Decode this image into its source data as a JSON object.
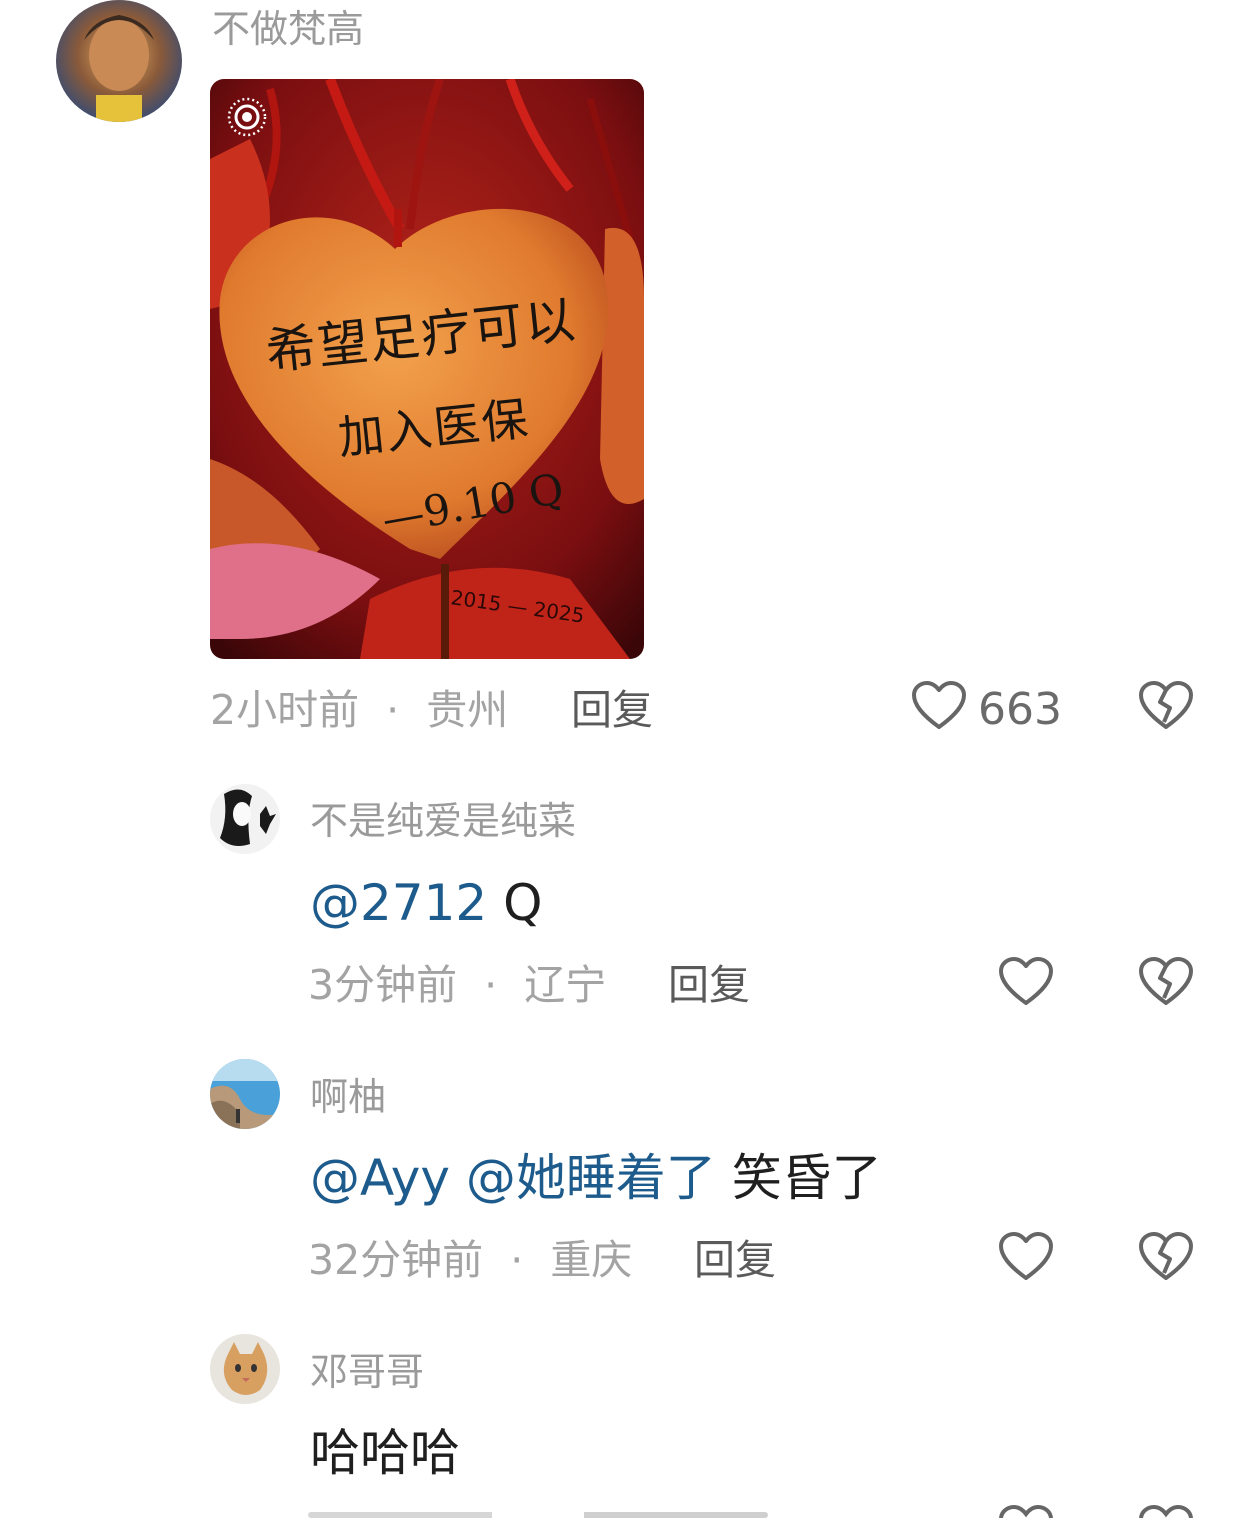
{
  "comments": [
    {
      "username": "不做梵高",
      "time": "2小时前",
      "location": "贵州",
      "reply_label": "回复",
      "like_count": "663",
      "image": {
        "handwriting_line1": "希望足疗可以",
        "handwriting_line2": "加入医保",
        "handwriting_line3": "—9.10 Q",
        "side_text": "2015 — 2025"
      }
    },
    {
      "username": "不是纯爱是纯菜",
      "mention": "@2712",
      "text": "Q",
      "time": "3分钟前",
      "location": "辽宁",
      "reply_label": "回复"
    },
    {
      "username": "啊柚",
      "mention": "@Ayy @她睡着了",
      "text": "笑昏了",
      "time": "32分钟前",
      "location": "重庆",
      "reply_label": "回复"
    },
    {
      "username": "邓哥哥",
      "text": "哈哈哈"
    }
  ],
  "icons": {
    "like": "heart-outline-icon",
    "dislike": "broken-heart-icon",
    "live_photo": "live-photo-icon"
  },
  "colors": {
    "mention": "#1d5b8c",
    "meta": "#a3a3a3",
    "icon": "#666666"
  }
}
